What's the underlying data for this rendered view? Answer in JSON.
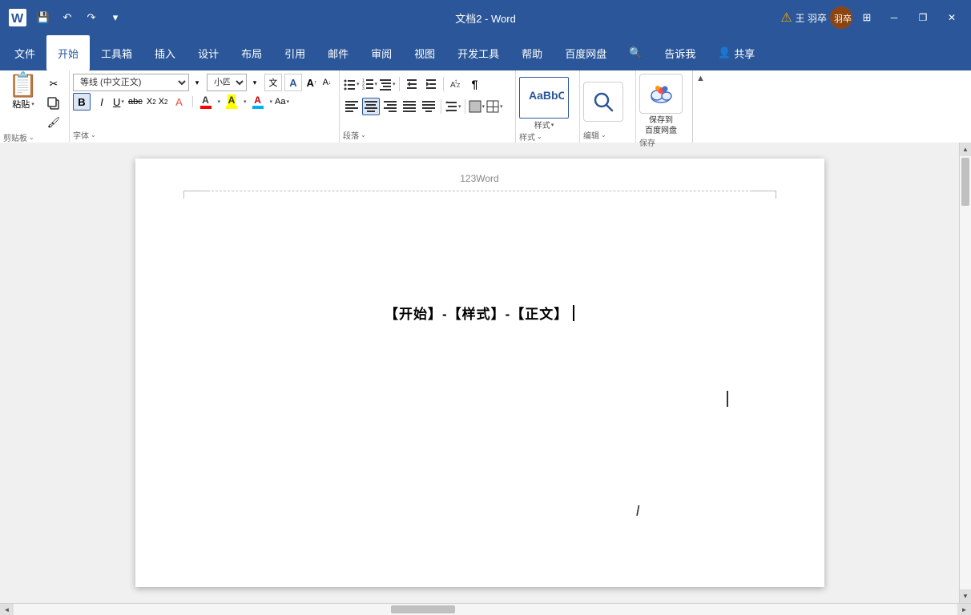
{
  "titlebar": {
    "title": "文档2 - Word",
    "appname": "Word",
    "docname": "文档2",
    "user": "王 羽卒",
    "qat_save": "💾",
    "qat_undo": "↶",
    "qat_redo": "↷",
    "qat_customize": "▾",
    "warning_icon": "⚠",
    "minimize": "─",
    "restore": "❐",
    "close": "✕"
  },
  "menubar": {
    "items": [
      {
        "label": "文件",
        "active": false
      },
      {
        "label": "开始",
        "active": true
      },
      {
        "label": "工具箱",
        "active": false
      },
      {
        "label": "插入",
        "active": false
      },
      {
        "label": "设计",
        "active": false
      },
      {
        "label": "布局",
        "active": false
      },
      {
        "label": "引用",
        "active": false
      },
      {
        "label": "邮件",
        "active": false
      },
      {
        "label": "审阅",
        "active": false
      },
      {
        "label": "视图",
        "active": false
      },
      {
        "label": "开发工具",
        "active": false
      },
      {
        "label": "帮助",
        "active": false
      },
      {
        "label": "百度网盘",
        "active": false
      },
      {
        "label": "🔍",
        "active": false
      },
      {
        "label": "告诉我",
        "active": false
      },
      {
        "label": "👤 共享",
        "active": false
      }
    ]
  },
  "ribbon": {
    "groups": {
      "clipboard": {
        "label": "剪贴板",
        "paste_label": "粘贴",
        "cut_label": "✂",
        "copy_label": "📋",
        "format_painter": "🖌"
      },
      "font": {
        "label": "字体",
        "font_name": "等线 (中文正文)",
        "font_size": "小四",
        "bold": "B",
        "italic": "I",
        "underline": "U",
        "strikethrough": "abc",
        "subscript": "X₂",
        "superscript": "X²",
        "clear_format": "A",
        "font_color": "A",
        "highlight_color": "A",
        "text_color": "A",
        "font_size_increase": "A↑",
        "font_size_decrease": "A↓",
        "change_case": "Aa",
        "phonetic": "wen"
      },
      "paragraph": {
        "label": "段落",
        "bullets": "≡",
        "numbering": "≡",
        "multilevel": "≡",
        "decrease_indent": "◁≡",
        "increase_indent": "≡▷",
        "sort": "↕A",
        "show_marks": "¶",
        "align_left": "≡",
        "align_center": "≡",
        "align_right": "≡",
        "justify": "≡",
        "distributed": "≡",
        "line_spacing": "↕",
        "shading": "▨",
        "borders": "⊞"
      },
      "styles": {
        "label": "样式",
        "style_label": "样式"
      },
      "editing": {
        "label": "编辑",
        "search_icon": "🔍",
        "search_label": "编辑"
      },
      "save": {
        "label": "保存",
        "save_label": "保存到\n百度网盘",
        "save_icon": "☁"
      }
    }
  },
  "document": {
    "header_text": "123Word",
    "content": "【开始】-【样式】-【正文】",
    "cursor": true
  },
  "scrollbar": {
    "up": "▲",
    "down": "▼",
    "left": "◄",
    "right": "►"
  }
}
